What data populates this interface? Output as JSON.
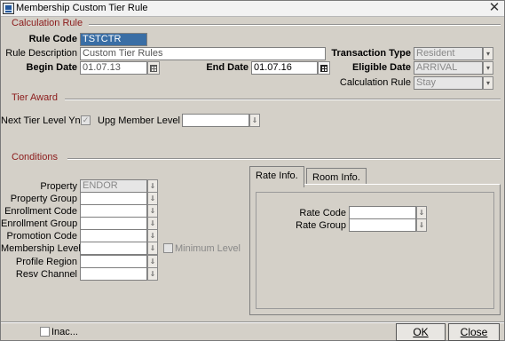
{
  "window": {
    "title": "Membership Custom Tier Rule"
  },
  "sections": {
    "calculation_rule": "Calculation Rule",
    "tier_award": "Tier Award",
    "conditions": "Conditions"
  },
  "calc": {
    "rule_code_label": "Rule Code",
    "rule_code_value": "TSTCTR",
    "rule_description_label": "Rule Description",
    "rule_description_value": "Custom Tier Rules",
    "begin_date_label": "Begin Date",
    "begin_date_value": "01.07.13",
    "end_date_label": "End Date",
    "end_date_value": "01.07.16",
    "transaction_type_label": "Transaction Type",
    "transaction_type_value": "Resident",
    "eligible_date_label": "Eligible Date",
    "eligible_date_value": "ARRIVAL",
    "calculation_rule_label": "Calculation Rule",
    "calculation_rule_value": "Stay"
  },
  "tier": {
    "next_tier_label": "Next Tier Level Yn",
    "next_tier_checked": true,
    "upg_member_label": "Upg Member Level",
    "upg_member_value": ""
  },
  "conditions": {
    "property_label": "Property",
    "property_value": "ENDOR",
    "property_group_label": "Property Group",
    "enrollment_code_label": "Enrollment Code",
    "enrollment_group_label": "Enrollment Group",
    "promotion_code_label": "Promotion Code",
    "membership_level_label": "Membership Level",
    "minimum_level_label": "Minimum Level",
    "profile_region_label": "Profile Region",
    "resv_channel_label": "Resv Channel"
  },
  "tabs": {
    "rate_info": "Rate Info.",
    "room_info": "Room Info.",
    "rate_code_label": "Rate Code",
    "rate_group_label": "Rate Group"
  },
  "footer": {
    "inactive_label": "Inac...",
    "ok_label": "OK",
    "close_label": "Close"
  },
  "icons": {
    "lov_arrow": "⇓",
    "dropdown_arrow": "▾",
    "check": "✓",
    "close": "✕"
  }
}
